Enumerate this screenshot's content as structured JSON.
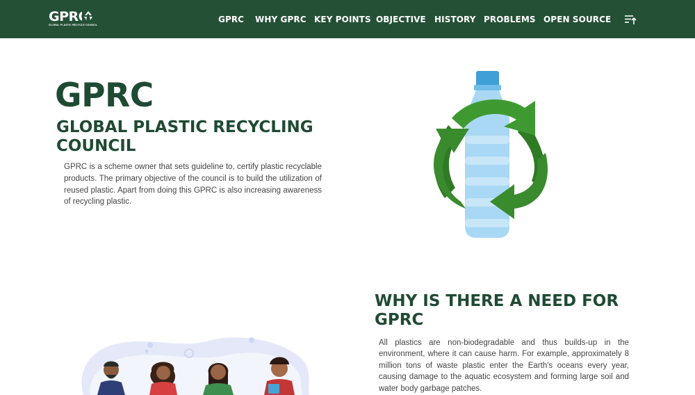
{
  "navbar": {
    "logo": {
      "text": "GPRC",
      "subtext": "GLOBAL PLASTIC RECYCLE COUNCIL"
    },
    "links": [
      "GPRC",
      "WHY GPRC",
      "KEY POINTS",
      "OBJECTIVE",
      "HISTORY",
      "PROBLEMS",
      "OPEN SOURCE"
    ],
    "menu_icon": "sort-menu-icon",
    "background": "#245035"
  },
  "hero": {
    "title": "GPRC",
    "subtitle": "GLOBAL PLASTIC RECYCLING COUNCIL",
    "description": "GPRC is a scheme owner that sets guideline to, certify plastic recyclable products. The primary objective of the council is to build the utilization of reused plastic. Apart from doing this GPRC is also increasing awareness of recycling plastic.",
    "image_icon": "recycle-bottle-illustration"
  },
  "why": {
    "title": "WHY IS THERE A NEED FOR GPRC",
    "description": "All plastics are non-biodegradable and thus builds-up in the environment, where it can cause harm. For example, approximately 8 million tons of waste plastic enter the Earth's oceans every year, causing damage to the aquatic ecosystem and forming large soil and water body garbage patches.",
    "image_icon": "people-recycling-illustration"
  },
  "colors": {
    "brand": "#245035",
    "heading": "#1f4a33",
    "recycle_green": "#3a8a2e",
    "bottle_blue": "#9fd0f0"
  }
}
